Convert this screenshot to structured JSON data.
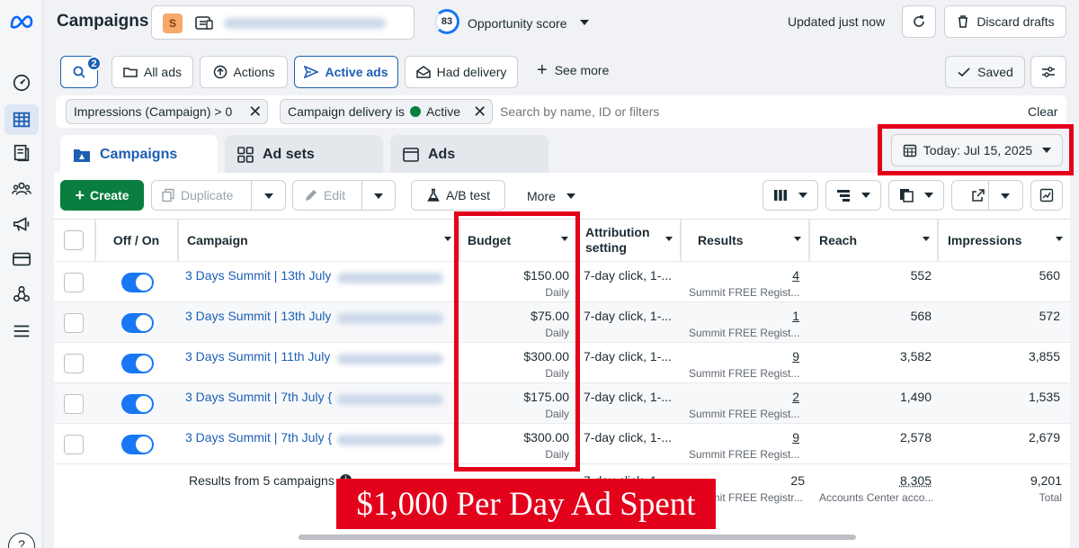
{
  "header": {
    "title": "Campaigns",
    "account_initial": "S",
    "opportunity_score": "83",
    "opportunity_label": "Opportunity score",
    "updated": "Updated just now",
    "discard": "Discard drafts"
  },
  "toolbar": {
    "search_badge": "2",
    "all_ads": "All ads",
    "actions": "Actions",
    "active_ads": "Active ads",
    "had_delivery": "Had delivery",
    "see_more": "See more",
    "saved": "Saved"
  },
  "filters": {
    "chip1": "Impressions (Campaign) > 0",
    "chip2_prefix": "Campaign delivery is",
    "chip2_value": "Active",
    "placeholder": "Search by name, ID or filters",
    "clear": "Clear"
  },
  "tabs": [
    {
      "label": "Campaigns"
    },
    {
      "label": "Ad sets"
    },
    {
      "label": "Ads"
    }
  ],
  "date_range": "Today: Jul 15, 2025",
  "actions": {
    "create": "Create",
    "duplicate": "Duplicate",
    "edit": "Edit",
    "ab_test": "A/B test",
    "more": "More"
  },
  "columns": {
    "off_on": "Off / On",
    "campaign": "Campaign",
    "budget": "Budget",
    "attribution": "Attribution setting",
    "results": "Results",
    "reach": "Reach",
    "impressions": "Impressions"
  },
  "rows": [
    {
      "name": "3 Days Summit | 13th July",
      "budget": "$150.00",
      "budget_period": "Daily",
      "attribution": "7-day click, 1-...",
      "results": "4",
      "result_type": "Summit FREE Regist...",
      "reach": "552",
      "impressions": "560"
    },
    {
      "name": "3 Days Summit | 13th July",
      "budget": "$75.00",
      "budget_period": "Daily",
      "attribution": "7-day click, 1-...",
      "results": "1",
      "result_type": "Summit FREE Regist...",
      "reach": "568",
      "impressions": "572"
    },
    {
      "name": "3 Days Summit | 11th July",
      "budget": "$300.00",
      "budget_period": "Daily",
      "attribution": "7-day click, 1-...",
      "results": "9",
      "result_type": "Summit FREE Regist...",
      "reach": "3,582",
      "impressions": "3,855"
    },
    {
      "name": "3 Days Summit | 7th July {",
      "budget": "$175.00",
      "budget_period": "Daily",
      "attribution": "7-day click, 1-...",
      "results": "2",
      "result_type": "Summit FREE Regist...",
      "reach": "1,490",
      "impressions": "1,535"
    },
    {
      "name": "3 Days Summit | 7th July {",
      "budget": "$300.00",
      "budget_period": "Daily",
      "attribution": "7-day click, 1-...",
      "results": "9",
      "result_type": "Summit FREE Regist...",
      "reach": "2,578",
      "impressions": "2,679"
    }
  ],
  "totals": {
    "label": "Results from 5 campaigns",
    "attribution": "7-day click, 1-...",
    "results": "25",
    "result_type": "Summit FREE Registr...",
    "reach": "8,305",
    "reach_sub": "Accounts Center acco...",
    "impressions": "9,201",
    "impressions_sub": "Total"
  },
  "overlay_caption": "$1,000 Per Day Ad Spent",
  "colors": {
    "accent": "#1c5fb3",
    "create": "#0a7e3f",
    "highlight": "#e3001b",
    "toggle": "#1877f2"
  }
}
